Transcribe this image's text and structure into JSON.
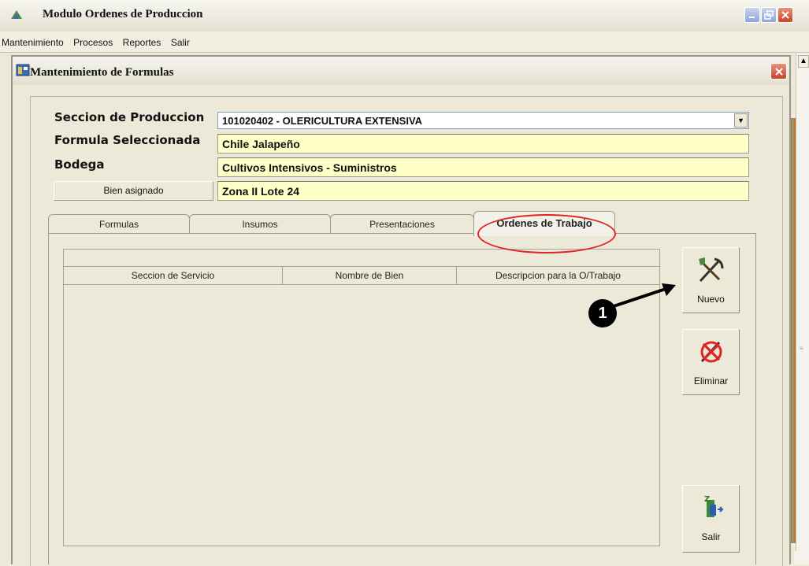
{
  "app": {
    "title": "Modulo Ordenes de Produccion",
    "menu": [
      "Mantenimiento",
      "Procesos",
      "Reportes",
      "Salir"
    ]
  },
  "child_window": {
    "title": "Mantenimiento de Formulas"
  },
  "form": {
    "seccion_label": "Seccion de Produccion",
    "seccion_value": "101020402 - OLERICULTURA EXTENSIVA",
    "formula_label": "Formula Seleccionada",
    "formula_value": "Chile Jalapeño",
    "bodega_label": "Bodega",
    "bodega_value": "Cultivos Intensivos - Suministros",
    "bien_button": "Bien asignado",
    "bien_value": "Zona II  Lote 24"
  },
  "tabs": [
    {
      "label": "Formulas"
    },
    {
      "label": "Insumos"
    },
    {
      "label": "Presentaciones"
    },
    {
      "label": "Ordenes de Trabajo",
      "active": true
    }
  ],
  "grid": {
    "columns": [
      "Seccion de Servicio",
      "Nombre de Bien",
      "Descripcion para la O/Trabajo"
    ]
  },
  "actions": {
    "nuevo": "Nuevo",
    "eliminar": "Eliminar",
    "salir": "Salir"
  },
  "annotation": {
    "callout_number": "1",
    "highlight_color": "#e32222"
  },
  "icons": {
    "app": "app-icon",
    "child": "form-window-icon",
    "nuevo": "shovel-pick-icon",
    "eliminar": "delete-shovel-icon",
    "salir": "exit-door-icon"
  }
}
